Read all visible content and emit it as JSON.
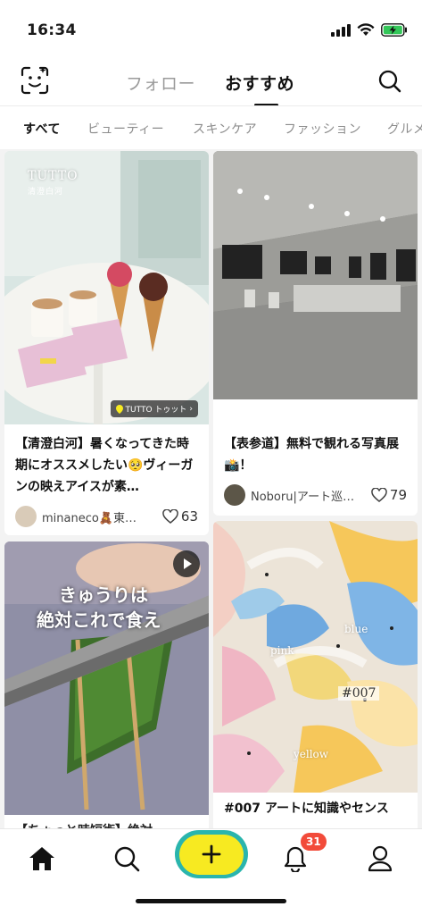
{
  "status_bar": {
    "time": "16:34"
  },
  "header": {
    "tab_follow": "フォロー",
    "tab_recommend": "おすすめ"
  },
  "categories": [
    "すべて",
    "ビューティー",
    "スキンケア",
    "ファッション",
    "グルメ"
  ],
  "feed": {
    "cards": [
      {
        "title": "【清澄白河】暑くなってきた時期にオススメしたい🥺ヴィーガンの映えアイスが素…",
        "image_brand": "TUTTO",
        "image_brand_sub": "清澄白河",
        "location_tag": "TUTTO トゥット",
        "author": "minaneco🧸東…",
        "likes": "63"
      },
      {
        "title": "【表参道】無料で観れる写真展📸！",
        "author": "Noboru|アート巡…",
        "likes": "79"
      },
      {
        "overlay_line1": "きゅうりは",
        "overlay_line2": "絶対これで食え",
        "title": "【ちょっと時短術】絶対…",
        "is_video": true
      },
      {
        "labels": [
          "blue",
          "pink",
          "#007",
          "yellow"
        ],
        "title": "#007 アートに知識やセンス"
      }
    ]
  },
  "bottom_nav": {
    "notification_count": "31"
  },
  "colors": {
    "accent_yellow": "#f7ea21",
    "accent_teal": "#2ab5ad",
    "badge_red": "#f24b3a"
  }
}
